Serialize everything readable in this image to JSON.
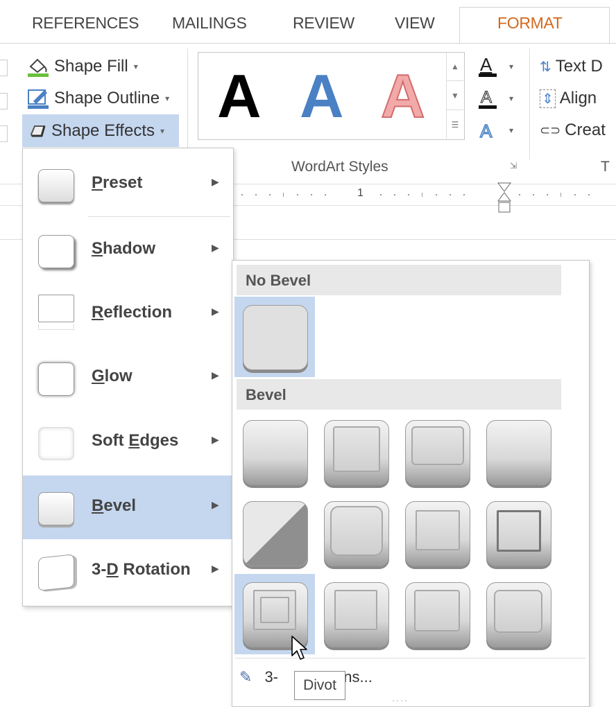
{
  "tabs": [
    {
      "label": "REFERENCES"
    },
    {
      "label": "MAILINGS"
    },
    {
      "label": "REVIEW"
    },
    {
      "label": "VIEW"
    },
    {
      "label": "FORMAT",
      "active": true
    }
  ],
  "ribbon": {
    "shape_fill": "Shape Fill",
    "shape_outline": "Shape Outline",
    "shape_effects": "Shape Effects",
    "wordart_letters": [
      "A",
      "A",
      "A"
    ],
    "wordart_group_label": "WordArt Styles",
    "text_direction": "Text D",
    "align_text": "Align",
    "create_link": "Creat",
    "text_group_label": "T",
    "ruler_mark": "1"
  },
  "colors": {
    "accent_orange": "#d2691e",
    "highlight_blue": "#c5d7ef",
    "wordart_blue": "#4a80c4",
    "wordart_pink": "#f2a9a9"
  },
  "effects_menu": {
    "items": [
      {
        "before": "",
        "key": "P",
        "after": "reset"
      },
      {
        "before": "",
        "key": "S",
        "after": "hadow"
      },
      {
        "before": "",
        "key": "R",
        "after": "eflection"
      },
      {
        "before": "",
        "key": "G",
        "after": "low"
      },
      {
        "before": "Soft ",
        "key": "E",
        "after": "dges"
      },
      {
        "before": "",
        "key": "B",
        "after": "evel"
      },
      {
        "before": "3-",
        "key": "D",
        "after": " Rotation"
      }
    ]
  },
  "bevel_menu": {
    "no_bevel_heading": "No Bevel",
    "bevel_heading": "Bevel",
    "options_prefix": "3-",
    "options_suffix": "ons...",
    "tooltip": "Divot"
  }
}
